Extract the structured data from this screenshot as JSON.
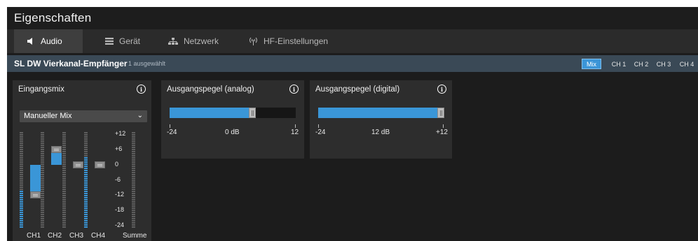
{
  "window": {
    "title": "Eigenschaften"
  },
  "tabs": [
    {
      "label": "Audio",
      "icon": "speaker-icon",
      "active": true
    },
    {
      "label": "Gerät",
      "icon": "device-icon",
      "active": false
    },
    {
      "label": "Netzwerk",
      "icon": "network-icon",
      "active": false
    },
    {
      "label": "HF-Einstellungen",
      "icon": "antenna-icon",
      "active": false
    }
  ],
  "device": {
    "name": "SL DW Vierkanal-Empfänger",
    "selection": "1 ausgewählt",
    "channel_buttons": [
      {
        "label": "Mix",
        "active": true
      },
      {
        "label": "CH 1",
        "active": false
      },
      {
        "label": "CH 2",
        "active": false
      },
      {
        "label": "CH 3",
        "active": false
      },
      {
        "label": "CH 4",
        "active": false
      }
    ]
  },
  "input_mix": {
    "title": "Eingangsmix",
    "mode": "Manueller Mix",
    "db_scale": [
      "+12",
      "+6",
      "0",
      "-6",
      "-12",
      "-18",
      "-24"
    ],
    "channels": [
      {
        "label": "CH1",
        "fader_db": -12,
        "meter_on": 18
      },
      {
        "label": "CH2",
        "fader_db": 6,
        "meter_on": 0
      },
      {
        "label": "CH3",
        "fader_db": 0,
        "meter_on": 0
      },
      {
        "label": "CH4",
        "fader_db": 0,
        "meter_on": 34
      }
    ],
    "sum_label": "Summe"
  },
  "output_analog": {
    "title": "Ausgangspegel (analog)",
    "value_label": "0 dB",
    "min_label": "-24",
    "max_label": "12",
    "value_fraction": 0.667
  },
  "output_digital": {
    "title": "Ausgangspegel (digital)",
    "value_label": "12 dB",
    "min_label": "-24",
    "max_label": "+12",
    "value_fraction": 1.0
  },
  "colors": {
    "accent": "#3a96d7",
    "device_bar": "#3a4956",
    "panel": "#2d2d2d",
    "background": "#1c1c1c"
  }
}
